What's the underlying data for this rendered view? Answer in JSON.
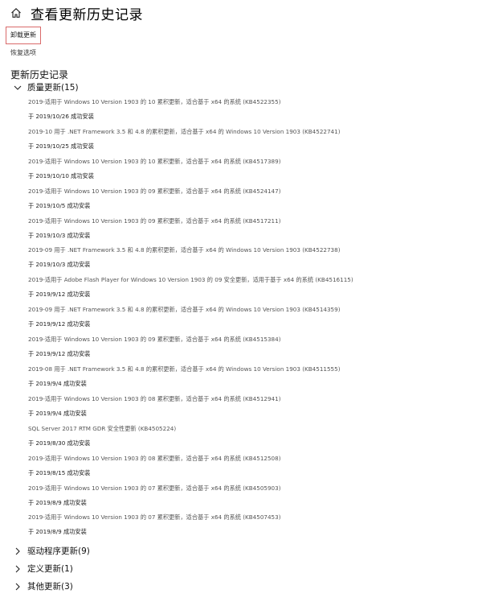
{
  "header": {
    "title": "查看更新历史记录",
    "home_icon": "home-icon"
  },
  "actions": {
    "uninstall_label": "卸载更新",
    "recovery_label": "恢复选项"
  },
  "history": {
    "title": "更新历史记录",
    "quality": {
      "label": "质量更新(15)",
      "expanded": true,
      "items": [
        {
          "title": "2019-适用于 Windows 10 Version 1903 的 10 累积更新，适合基于 x64 的系统 (KB4522355)",
          "status": "于 2019/10/26 成功安装"
        },
        {
          "title": "2019-10 用于 .NET Framework 3.5 和 4.8 的累积更新，适合基于 x64 的 Windows 10 Version 1903 (KB4522741)",
          "status": "于 2019/10/25 成功安装"
        },
        {
          "title": "2019-适用于 Windows 10 Version 1903 的 10 累积更新，适合基于 x64 的系统 (KB4517389)",
          "status": "于 2019/10/10 成功安装"
        },
        {
          "title": "2019-适用于 Windows 10 Version 1903 的 09 累积更新，适合基于 x64 的系统 (KB4524147)",
          "status": "于 2019/10/5 成功安装"
        },
        {
          "title": "2019-适用于 Windows 10 Version 1903 的 09 累积更新，适合基于 x64 的系统 (KB4517211)",
          "status": "于 2019/10/3 成功安装"
        },
        {
          "title": "2019-09 用于 .NET Framework 3.5 和 4.8 的累积更新，适合基于 x64 的 Windows 10 Version 1903 (KB4522738)",
          "status": "于 2019/10/3 成功安装"
        },
        {
          "title": "2019-适用于 Adobe Flash Player for Windows 10 Version 1903 的 09 安全更新，适用于基于 x64 的系统 (KB4516115)",
          "status": "于 2019/9/12 成功安装"
        },
        {
          "title": "2019-09 用于 .NET Framework 3.5 和 4.8 的累积更新，适合基于 x64 的 Windows 10 Version 1903 (KB4514359)",
          "status": "于 2019/9/12 成功安装"
        },
        {
          "title": "2019-适用于 Windows 10 Version 1903 的 09 累积更新，适合基于 x64 的系统 (KB4515384)",
          "status": "于 2019/9/12 成功安装"
        },
        {
          "title": "2019-08 用于 .NET Framework 3.5 和 4.8 的累积更新，适合基于 x64 的 Windows 10 Version 1903 (KB4511555)",
          "status": "于 2019/9/4 成功安装"
        },
        {
          "title": "2019-适用于 Windows 10 Version 1903 的 08 累积更新，适合基于 x64 的系统 (KB4512941)",
          "status": "于 2019/9/4 成功安装"
        },
        {
          "title": "SQL Server 2017 RTM GDR 安全性更新 (KB4505224)",
          "status": "于 2019/8/30 成功安装"
        },
        {
          "title": "2019-适用于 Windows 10 Version 1903 的 08 累积更新，适合基于 x64 的系统 (KB4512508)",
          "status": "于 2019/8/15 成功安装"
        },
        {
          "title": "2019-适用于 Windows 10 Version 1903 的 07 累积更新，适合基于 x64 的系统 (KB4505903)",
          "status": "于 2019/8/9 成功安装"
        },
        {
          "title": "2019-适用于 Windows 10 Version 1903 的 07 累积更新，适合基于 x64 的系统 (KB4507453)",
          "status": "于 2019/8/9 成功安装"
        }
      ]
    },
    "driver": {
      "label": "驱动程序更新(9)",
      "expanded": false
    },
    "definition": {
      "label": "定义更新(1)",
      "expanded": false
    },
    "other": {
      "label": "其他更新(3)",
      "expanded": false
    }
  }
}
